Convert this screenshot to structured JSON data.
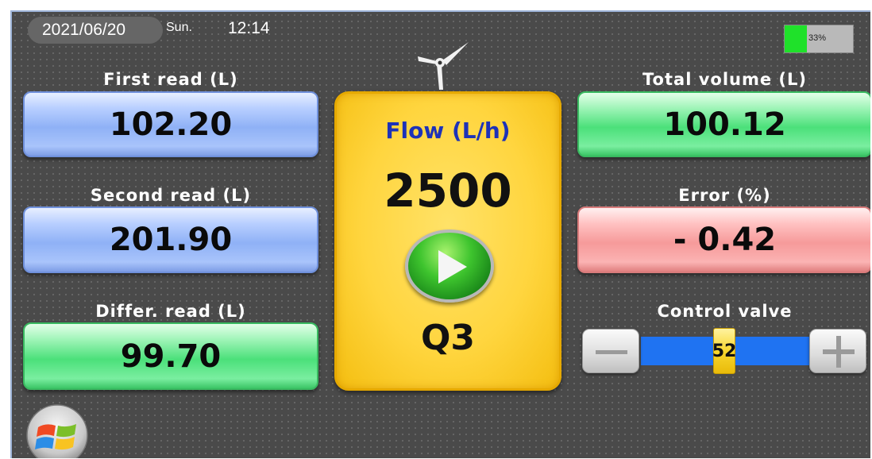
{
  "status_bar": {
    "date": "2021/06/20",
    "day": "Sun.",
    "time": "12:14",
    "battery_level": 0.33,
    "battery_label": "33%"
  },
  "readings": {
    "first_read": {
      "label": "First read (L)",
      "value": "102.20"
    },
    "second_read": {
      "label": "Second read (L)",
      "value": "201.90"
    },
    "differ_read": {
      "label": "Differ. read (L)",
      "value": "99.70"
    },
    "total_volume": {
      "label": "Total volume (L)",
      "value": "100.12"
    },
    "error": {
      "label": "Error (%)",
      "value": "- 0.42"
    }
  },
  "flow": {
    "label": "Flow (L/h)",
    "value": "2500",
    "mode": "Q3"
  },
  "control_valve": {
    "label": "Control valve",
    "value": "52",
    "level": 0.52
  },
  "icons": {
    "logo": "wind-turbine-icon",
    "play": "play-icon",
    "start": "windows-start-icon",
    "minus": "minus-icon",
    "plus": "plus-icon"
  },
  "colors": {
    "background": "#4a4a4a",
    "card_blue": "#8fb1f6",
    "card_green": "#4be07a",
    "card_red": "#f69a9a",
    "flow_panel": "#ffd53e",
    "flow_label": "#1d32b8",
    "valve_track": "#1f73f2",
    "battery_fill": "#1fe12a"
  }
}
